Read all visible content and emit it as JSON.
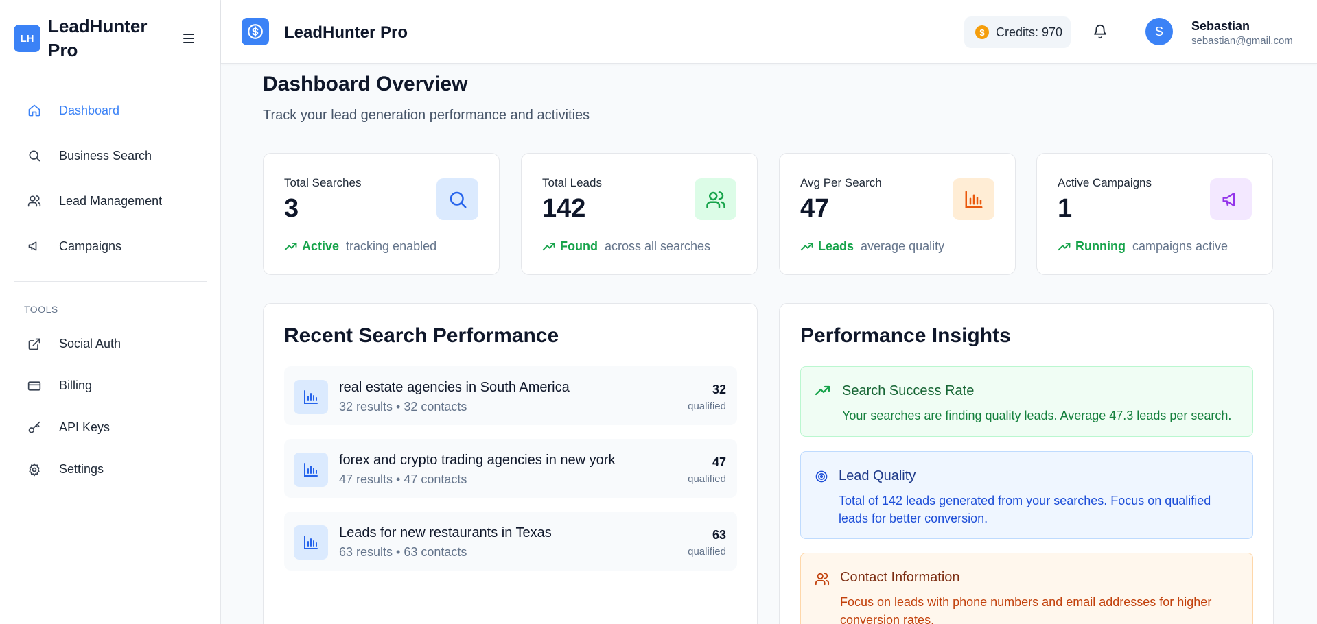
{
  "sidebar": {
    "brand_logo": "LH",
    "brand_name": "LeadHunter Pro",
    "nav": [
      {
        "label": "Dashboard",
        "icon": "home-icon",
        "active": true
      },
      {
        "label": "Business Search",
        "icon": "search-icon"
      },
      {
        "label": "Lead Management",
        "icon": "users-icon"
      },
      {
        "label": "Campaigns",
        "icon": "megaphone-icon"
      }
    ],
    "tools_label": "TOOLS",
    "tools": [
      {
        "label": "Social Auth",
        "icon": "external-link-icon"
      },
      {
        "label": "Billing",
        "icon": "credit-card-icon"
      },
      {
        "label": "API Keys",
        "icon": "key-icon"
      },
      {
        "label": "Settings",
        "icon": "gear-icon"
      }
    ]
  },
  "header": {
    "title": "LeadHunter Pro",
    "credits": "Credits: 970",
    "coin_symbol": "$",
    "user": {
      "initial": "S",
      "name": "Sebastian",
      "email": "sebastian@gmail.com"
    }
  },
  "page": {
    "title": "Dashboard Overview",
    "subtitle": "Track your lead generation performance and activities"
  },
  "stats": [
    {
      "label": "Total Searches",
      "value": "3",
      "highlight": "Active",
      "rest": "tracking enabled",
      "icon": "search-icon",
      "bg": "#dbeafe",
      "fg": "#2563eb"
    },
    {
      "label": "Total Leads",
      "value": "142",
      "highlight": "Found",
      "rest": "across all searches",
      "icon": "users-icon",
      "bg": "#dcfce7",
      "fg": "#16a34a"
    },
    {
      "label": "Avg Per Search",
      "value": "47",
      "highlight": "Leads",
      "rest": "average quality",
      "icon": "bar-chart-icon",
      "bg": "#ffedd5",
      "fg": "#ea580c"
    },
    {
      "label": "Active Campaigns",
      "value": "1",
      "highlight": "Running",
      "rest": "campaigns active",
      "icon": "megaphone-icon",
      "bg": "#f3e8ff",
      "fg": "#9333ea"
    }
  ],
  "recent": {
    "title": "Recent Search Performance",
    "items": [
      {
        "title": "real estate agencies in South America",
        "meta": "32 results • 32 contacts",
        "count": "32",
        "qualified": "qualified"
      },
      {
        "title": "forex and crypto trading agencies in new york",
        "meta": "47 results • 47 contacts",
        "count": "47",
        "qualified": "qualified"
      },
      {
        "title": "Leads for new restaurants in Texas",
        "meta": "63 results • 63 contacts",
        "count": "63",
        "qualified": "qualified"
      }
    ]
  },
  "insights": {
    "title": "Performance Insights",
    "items": [
      {
        "title": "Search Success Rate",
        "text": "Your searches are finding quality leads. Average 47.3 leads per search.",
        "icon": "trending-up-icon",
        "bg": "#f0fdf4",
        "border": "#bbf7d0",
        "title_color": "#166534",
        "text_color": "#15803d"
      },
      {
        "title": "Lead Quality",
        "text": "Total of 142 leads generated from your searches. Focus on qualified leads for better conversion.",
        "icon": "target-icon",
        "bg": "#eff6ff",
        "border": "#bfdbfe",
        "title_color": "#1e3a8a",
        "text_color": "#1d4ed8"
      },
      {
        "title": "Contact Information",
        "text": "Focus on leads with phone numbers and email addresses for higher conversion rates.",
        "icon": "users-icon",
        "bg": "#fff7ed",
        "border": "#fed7aa",
        "title_color": "#7c2d12",
        "text_color": "#c2410c"
      }
    ]
  }
}
